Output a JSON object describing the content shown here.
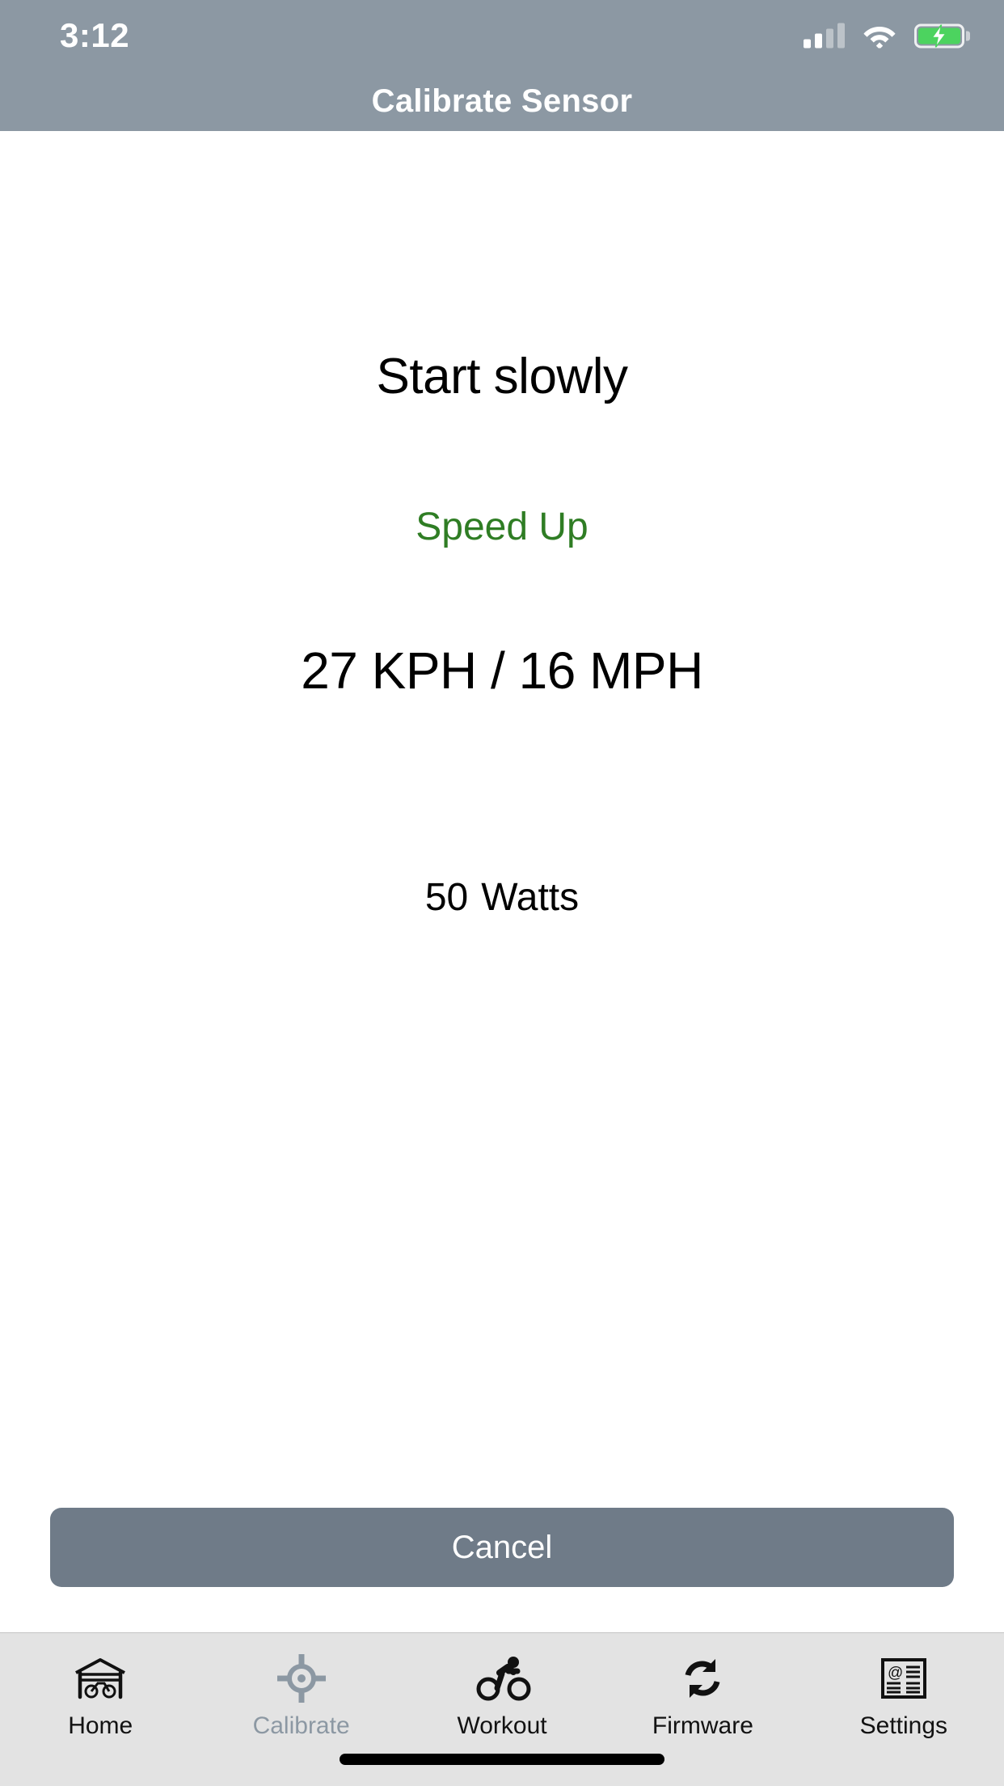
{
  "status_bar": {
    "time": "3:12",
    "signal_icon": "cellular-signal-icon",
    "signal_bars_filled": 2,
    "signal_bars_total": 4,
    "wifi_icon": "wifi-icon",
    "battery_icon": "battery-charging-icon",
    "battery_color": "#4cd35f"
  },
  "header": {
    "title": "Calibrate Sensor",
    "background_color": "#8c98a3",
    "text_color": "#ffffff"
  },
  "main": {
    "instruction": "Start slowly",
    "cue": "Speed Up",
    "cue_color": "#2f7d24",
    "speed_readout": "27 KPH / 16 MPH",
    "speed_kph": 27,
    "speed_mph": 16,
    "power_value": "50",
    "power_unit": "Watts",
    "power_watts": 50
  },
  "actions": {
    "cancel_label": "Cancel",
    "cancel_color": "#6f7b88"
  },
  "tab_bar": {
    "background_color": "#e3e3e3",
    "active_color": "#8c98a3",
    "inactive_color": "#121212",
    "items": [
      {
        "label": "Home",
        "icon": "garage-bike-icon",
        "active": false
      },
      {
        "label": "Calibrate",
        "icon": "crosshair-icon",
        "active": true
      },
      {
        "label": "Workout",
        "icon": "cyclist-icon",
        "active": false
      },
      {
        "label": "Firmware",
        "icon": "sync-refresh-icon",
        "active": false
      },
      {
        "label": "Settings",
        "icon": "document-at-icon",
        "active": false
      }
    ]
  }
}
